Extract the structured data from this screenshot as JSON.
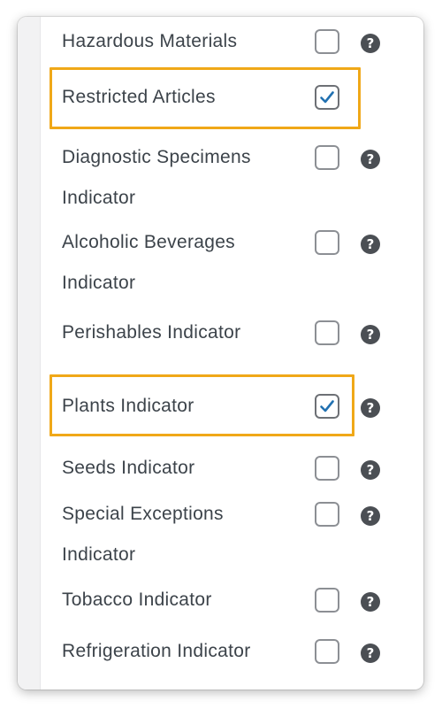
{
  "options": [
    {
      "label": "Hazardous Materials",
      "checked": false,
      "help_icon": "question-circle-icon",
      "help_glyph": "?"
    },
    {
      "label": "Restricted Articles",
      "checked": true,
      "highlighted": true
    },
    {
      "label": "Diagnostic Specimens Indicator",
      "checked": false,
      "help_icon": "question-circle-icon",
      "help_glyph": "?"
    },
    {
      "label": "Alcoholic Beverages Indicator",
      "checked": false,
      "help_icon": "question-circle-icon",
      "help_glyph": "?"
    },
    {
      "label": "Perishables Indicator",
      "checked": false,
      "help_icon": "question-circle-icon",
      "help_glyph": "?"
    },
    {
      "label": "Plants Indicator",
      "checked": true,
      "highlighted": true,
      "help_icon": "question-circle-icon",
      "help_glyph": "?"
    },
    {
      "label": "Seeds Indicator",
      "checked": false,
      "help_icon": "question-circle-icon",
      "help_glyph": "?"
    },
    {
      "label": "Special Exceptions Indicator",
      "checked": false,
      "help_icon": "question-circle-icon",
      "help_glyph": "?"
    },
    {
      "label": "Tobacco Indicator",
      "checked": false,
      "help_icon": "question-circle-icon",
      "help_glyph": "?"
    },
    {
      "label": "Refrigeration Indicator",
      "checked": false,
      "help_icon": "question-circle-icon",
      "help_glyph": "?"
    }
  ],
  "colors": {
    "highlight": "#f0a818",
    "checkmark": "#2271b1",
    "help_icon": "#4b4f54"
  }
}
